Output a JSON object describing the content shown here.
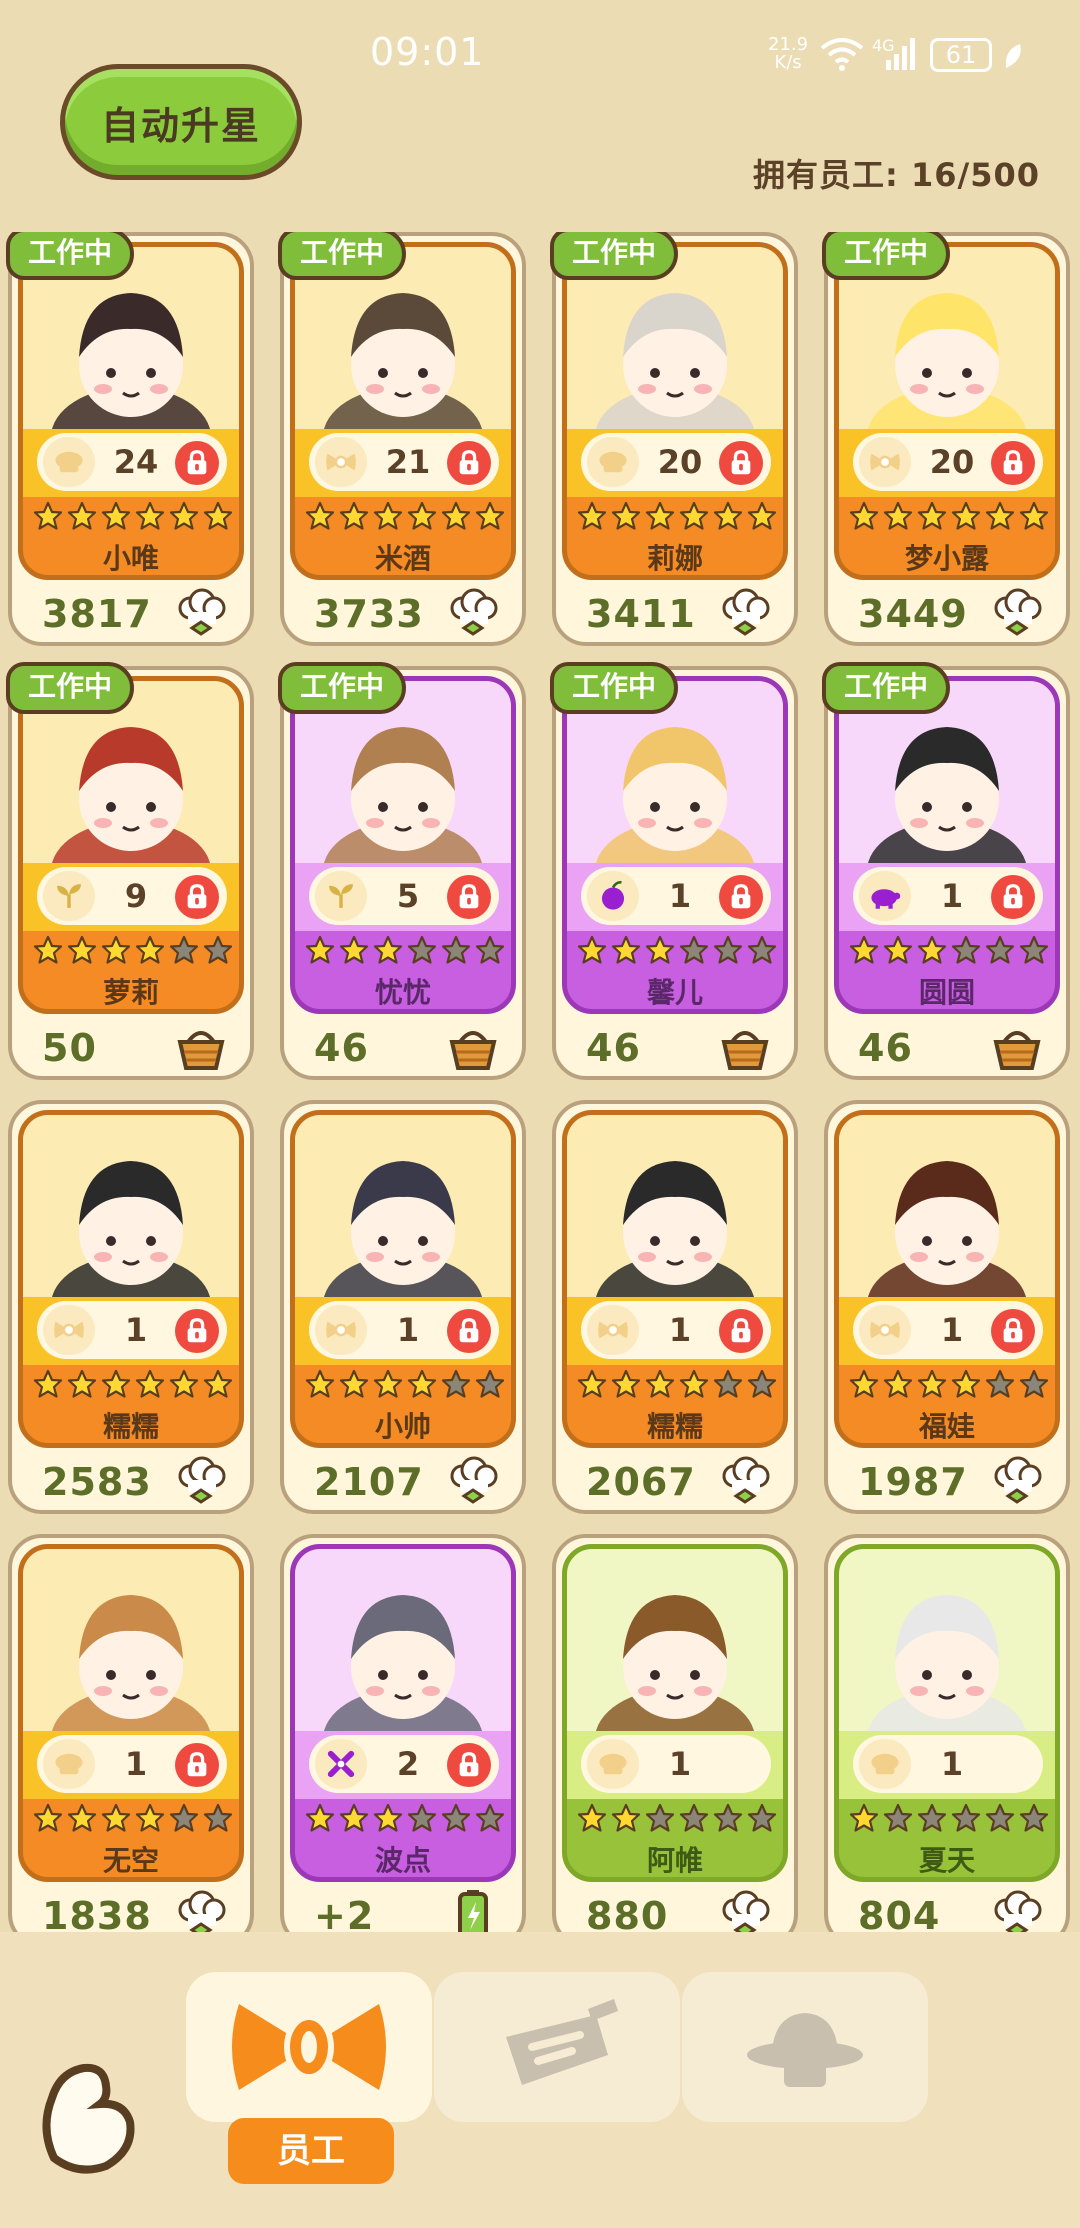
{
  "status_bar": {
    "time": "09:01",
    "net_speed": "21.9",
    "net_unit": "K/s",
    "network": "4G",
    "battery": "61"
  },
  "header": {
    "auto_star_label": "自动升星",
    "employee_count": "拥有员工: 16/500"
  },
  "cards": [
    {
      "name": "小唯",
      "level": "24",
      "stars": 6,
      "value": "3817",
      "working": true,
      "color": "orange",
      "skill_icon": "chef-hat-icon",
      "value_icon": "chef-hat-icon"
    },
    {
      "name": "米酒",
      "level": "21",
      "stars": 6,
      "value": "3733",
      "working": true,
      "color": "orange",
      "skill_icon": "bow-icon",
      "value_icon": "chef-hat-icon"
    },
    {
      "name": "莉娜",
      "level": "20",
      "stars": 6,
      "value": "3411",
      "working": true,
      "color": "orange",
      "skill_icon": "chef-hat-icon",
      "value_icon": "chef-hat-icon"
    },
    {
      "name": "梦小露",
      "level": "20",
      "stars": 6,
      "value": "3449",
      "working": true,
      "color": "orange",
      "skill_icon": "bow-icon",
      "value_icon": "chef-hat-icon"
    },
    {
      "name": "萝莉",
      "level": "9",
      "stars": 4,
      "value": "50",
      "working": true,
      "color": "orange",
      "skill_icon": "sprout-icon",
      "value_icon": "basket-icon"
    },
    {
      "name": "忧忧",
      "level": "5",
      "stars": 3,
      "value": "46",
      "working": true,
      "color": "purple",
      "skill_icon": "sprout-icon",
      "value_icon": "basket-icon"
    },
    {
      "name": "馨儿",
      "level": "1",
      "stars": 3,
      "value": "46",
      "working": true,
      "color": "purple",
      "skill_icon": "apple-icon",
      "value_icon": "basket-icon"
    },
    {
      "name": "圆圆",
      "level": "1",
      "stars": 3,
      "value": "46",
      "working": true,
      "color": "purple",
      "skill_icon": "pig-icon",
      "value_icon": "basket-icon"
    },
    {
      "name": "糯糯",
      "level": "1",
      "stars": 6,
      "value": "2583",
      "working": false,
      "color": "orange",
      "skill_icon": "bow-icon",
      "value_icon": "chef-hat-icon"
    },
    {
      "name": "小帅",
      "level": "1",
      "stars": 4,
      "value": "2107",
      "working": false,
      "color": "orange",
      "skill_icon": "bow-icon",
      "value_icon": "chef-hat-icon"
    },
    {
      "name": "糯糯",
      "level": "1",
      "stars": 4,
      "value": "2067",
      "working": false,
      "color": "orange",
      "skill_icon": "bow-icon",
      "value_icon": "chef-hat-icon"
    },
    {
      "name": "福娃",
      "level": "1",
      "stars": 4,
      "value": "1987",
      "working": false,
      "color": "orange",
      "skill_icon": "bow-icon",
      "value_icon": "chef-hat-icon"
    },
    {
      "name": "无空",
      "level": "1",
      "stars": 4,
      "value": "1838",
      "working": false,
      "color": "orange",
      "skill_icon": "chef-hat-icon",
      "value_icon": "chef-hat-icon"
    },
    {
      "name": "波点",
      "level": "2",
      "stars": 3,
      "value": "+2",
      "working": false,
      "color": "purple",
      "skill_icon": "cross-icon",
      "value_icon": "battery-icon"
    },
    {
      "name": "阿帷",
      "level": "1",
      "stars": 2,
      "value": "880",
      "working": false,
      "color": "green",
      "skill_icon": "chef-hat-icon",
      "value_icon": "chef-hat-icon"
    },
    {
      "name": "夏天",
      "level": "1",
      "stars": 1,
      "value": "804",
      "working": false,
      "color": "green",
      "skill_icon": "chef-hat-icon",
      "value_icon": "chef-hat-icon"
    }
  ],
  "badge_text": "工作中",
  "bottom_nav": {
    "active_tab": "员工",
    "tabs": [
      "employees-bow-icon",
      "menu-card-icon",
      "hat-icon"
    ]
  }
}
